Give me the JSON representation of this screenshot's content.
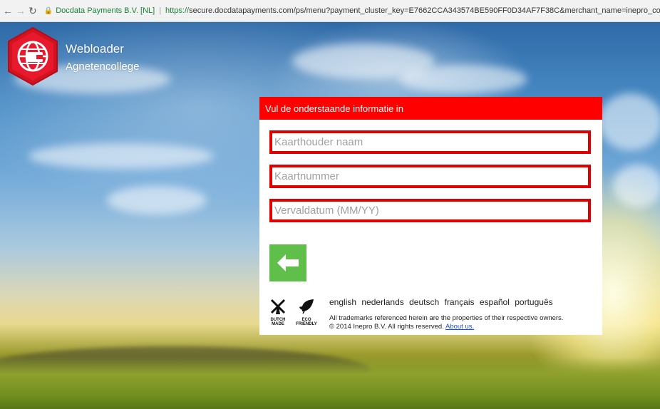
{
  "browser": {
    "site_identity": "Docdata Payments B.V. [NL]",
    "url_scheme": "https://",
    "url_rest": "secure.docdatapayments.com/ps/menu?payment_cluster_key=E7662CCA343574BE590FF0D34AF7F38C&merchant_name=inepro_com&client_"
  },
  "brand": {
    "name": "Webloader",
    "subtitle": "Agnetencollege",
    "accent_color": "#e8192c"
  },
  "form": {
    "header": "Vul de onderstaande informatie in",
    "cardholder_placeholder": "Kaarthouder naam",
    "cardnumber_placeholder": "Kaartnummer",
    "expiry_placeholder": "Vervaldatum (MM/YY)",
    "header_color": "#ff0000",
    "back_button_color": "#5fbf4a"
  },
  "badges": {
    "dutch_line1": "DUTCH",
    "dutch_line2": "MADE",
    "eco_line1": "ECO",
    "eco_line2": "FRIENDLY"
  },
  "languages": [
    "english",
    "nederlands",
    "deutsch",
    "français",
    "español",
    "português"
  ],
  "legal": {
    "trademarks": "All trademarks referenced herein are the properties of their respective owners.",
    "copyright": "© 2014 Inepro B.V. All rights reserved.",
    "about_link": "About us."
  }
}
